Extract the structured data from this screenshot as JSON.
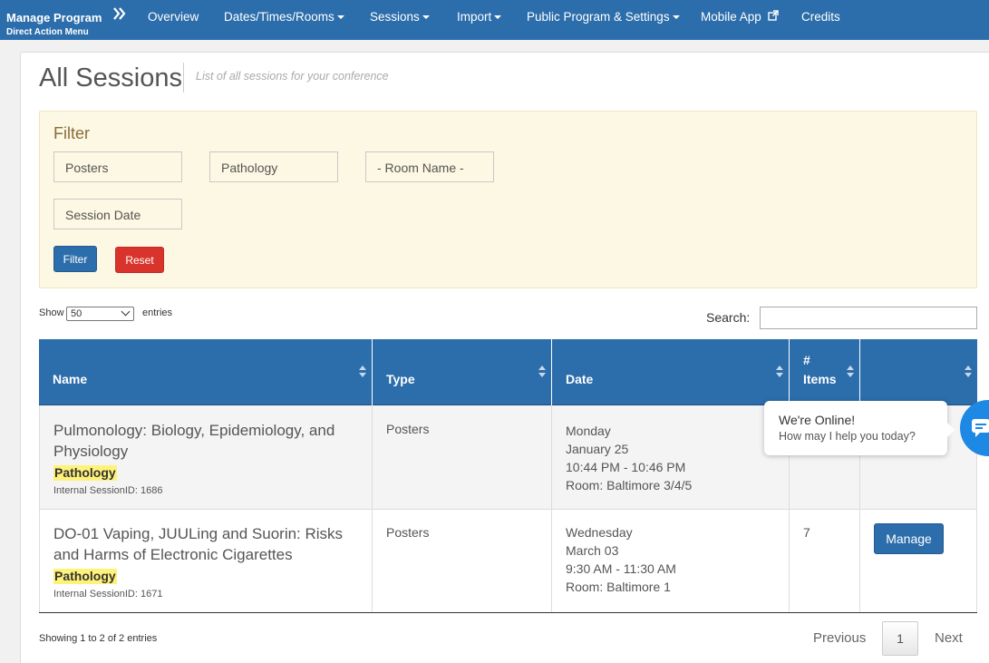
{
  "nav": {
    "brand_title": "Manage Program",
    "brand_sub": "Direct Action Menu",
    "items": [
      {
        "label": "Overview"
      },
      {
        "label": "Dates/Times/Rooms"
      },
      {
        "label": "Sessions"
      },
      {
        "label": "Import"
      },
      {
        "label": "Public Program & Settings"
      },
      {
        "label": "Mobile App"
      },
      {
        "label": "Credits"
      }
    ]
  },
  "page": {
    "title": "All Sessions",
    "subtitle": "List of all sessions for your conference"
  },
  "filter": {
    "title": "Filter",
    "type_value": "Posters",
    "track_value": "Pathology",
    "room_value": "- Room Name -",
    "date_placeholder": "Session Date",
    "filter_label": "Filter",
    "reset_label": "Reset"
  },
  "table_controls": {
    "show_label": "Show",
    "page_size": "50",
    "entries_label": "entries",
    "search_label": "Search:",
    "search_value": ""
  },
  "table": {
    "columns": [
      "Name",
      "Type",
      "Date",
      "# Items",
      ""
    ],
    "rows": [
      {
        "name": "Pulmonology: Biology, Epidemiology, and Physiology",
        "tag": "Pathology",
        "internal_id": "Internal SessionID: 1686",
        "type": "Posters",
        "day": "Monday",
        "date": "January 25",
        "time": "10:44 PM - 10:46 PM",
        "room": "Room: Baltimore 3/4/5",
        "items": ""
      },
      {
        "name": "DO-01 Vaping, JUULing and Suorin: Risks and Harms of Electronic Cigarettes",
        "tag": "Pathology",
        "internal_id": "Internal SessionID: 1671",
        "type": "Posters",
        "day": "Wednesday",
        "date": "March 03",
        "time": "9:30 AM - 11:30 AM",
        "room": "Room: Baltimore 1",
        "items": "7",
        "action": "Manage"
      }
    ]
  },
  "pagination": {
    "showing": "Showing 1 to 2 of 2 entries",
    "previous": "Previous",
    "current": "1",
    "next": "Next"
  },
  "chat": {
    "title": "We're Online!",
    "subtitle": "How may I help you today?"
  },
  "colors": {
    "primary": "#2c6dab",
    "danger": "#d9342b",
    "filter_bg": "#fcf8e3",
    "highlight": "#fff27a",
    "chat": "#1e88e5"
  }
}
